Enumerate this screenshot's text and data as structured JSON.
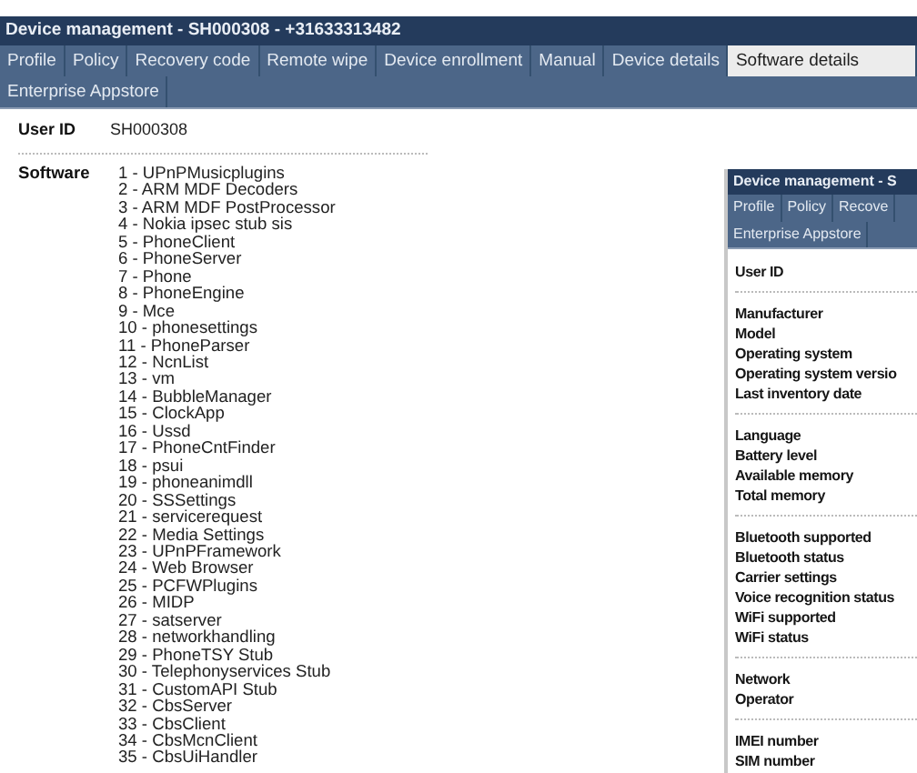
{
  "window": {
    "title": "Device management - SH000308 - +31633313482"
  },
  "tabs": [
    {
      "label": "Profile",
      "selected": false
    },
    {
      "label": "Policy",
      "selected": false
    },
    {
      "label": "Recovery code",
      "selected": false
    },
    {
      "label": "Remote wipe",
      "selected": false
    },
    {
      "label": "Device enrollment",
      "selected": false
    },
    {
      "label": "Manual",
      "selected": false
    },
    {
      "label": "Device details",
      "selected": false
    },
    {
      "label": "Software details",
      "selected": true
    },
    {
      "label": "Enterprise Appstore",
      "selected": false
    }
  ],
  "user_id": {
    "label": "User ID",
    "value": "SH000308"
  },
  "software": {
    "label": "Software",
    "items": [
      "1 - UPnPMusicplugins",
      "2 - ARM MDF Decoders",
      "3 - ARM MDF PostProcessor",
      "4 - Nokia ipsec stub sis",
      "5 - PhoneClient",
      "6 - PhoneServer",
      "7 - Phone",
      "8 - PhoneEngine",
      "9 - Mce",
      "10 - phonesettings",
      "11 - PhoneParser",
      "12 - NcnList",
      "13 - vm",
      "14 - BubbleManager",
      "15 - ClockApp",
      "16 - Ussd",
      "17 - PhoneCntFinder",
      "18 - psui",
      "19 - phoneanimdll",
      "20 - SSSettings",
      "21 - servicerequest",
      "22 - Media Settings",
      "23 - UPnPFramework",
      "24 - Web Browser",
      "25 - PCFWPlugins",
      "26 - MIDP",
      "27 - satserver",
      "28 - networkhandling",
      "29 - PhoneTSY Stub",
      "30 - Telephonyservices Stub",
      "31 - CustomAPI Stub",
      "32 - CbsServer",
      "33 - CbsClient",
      "34 - CbsMcnClient",
      "35 - CbsUiHandler"
    ]
  },
  "inset": {
    "title": "Device management - S",
    "tabs": [
      {
        "label": "Profile",
        "selected": false
      },
      {
        "label": "Policy",
        "selected": false
      },
      {
        "label": "Recove",
        "selected": false
      },
      {
        "label": "Enterprise Appstore",
        "selected": false
      }
    ],
    "user_id_label": "User ID",
    "sections": [
      [
        "Manufacturer",
        "Model",
        "Operating system",
        "Operating system versio",
        "Last inventory date"
      ],
      [
        "Language",
        "Battery level",
        "Available memory",
        "Total memory"
      ],
      [
        "Bluetooth supported",
        "Bluetooth status",
        "Carrier settings",
        "Voice recognition status",
        "WiFi supported",
        "WiFi status"
      ],
      [
        "Network",
        "Operator"
      ],
      [
        "IMEI number",
        "SIM number"
      ]
    ]
  }
}
